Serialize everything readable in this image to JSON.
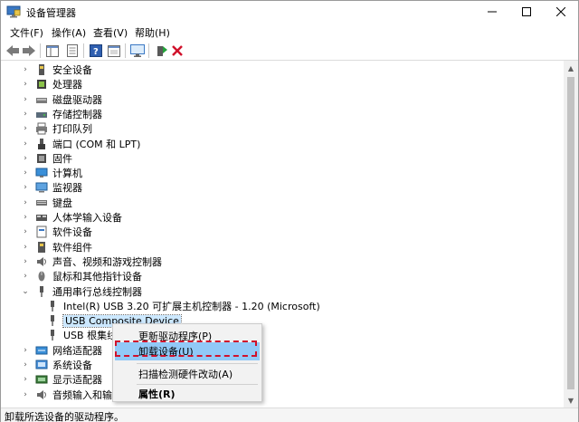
{
  "window": {
    "title": "设备管理器"
  },
  "menu": [
    "文件(F)",
    "操作(A)",
    "查看(V)",
    "帮助(H)"
  ],
  "tree": [
    {
      "label": "安全设备",
      "icon": "security-device-icon",
      "expander": "›"
    },
    {
      "label": "处理器",
      "icon": "processor-icon",
      "expander": "›"
    },
    {
      "label": "磁盘驱动器",
      "icon": "disk-drive-icon",
      "expander": "›"
    },
    {
      "label": "存储控制器",
      "icon": "storage-controller-icon",
      "expander": "›"
    },
    {
      "label": "打印队列",
      "icon": "printer-icon",
      "expander": "›"
    },
    {
      "label": "端口 (COM 和 LPT)",
      "icon": "port-icon",
      "expander": "›"
    },
    {
      "label": "固件",
      "icon": "firmware-icon",
      "expander": "›"
    },
    {
      "label": "计算机",
      "icon": "computer-icon",
      "expander": "›"
    },
    {
      "label": "监视器",
      "icon": "monitor-icon",
      "expander": "›"
    },
    {
      "label": "键盘",
      "icon": "keyboard-icon",
      "expander": "›"
    },
    {
      "label": "人体学输入设备",
      "icon": "hid-icon",
      "expander": "›"
    },
    {
      "label": "软件设备",
      "icon": "software-device-icon",
      "expander": "›"
    },
    {
      "label": "软件组件",
      "icon": "software-component-icon",
      "expander": "›"
    },
    {
      "label": "声音、视频和游戏控制器",
      "icon": "sound-icon",
      "expander": "›"
    },
    {
      "label": "鼠标和其他指针设备",
      "icon": "mouse-icon",
      "expander": "›"
    },
    {
      "label": "通用串行总线控制器",
      "icon": "usb-controller-icon",
      "expander": "⌄"
    },
    {
      "label": "Intel(R) USB 3.20 可扩展主机控制器 - 1.20 (Microsoft)",
      "icon": "usb-icon",
      "child": true
    },
    {
      "label": "USB Composite Device",
      "icon": "usb-icon",
      "child": true,
      "selected": true
    },
    {
      "label": "USB 根集线器",
      "icon": "usb-icon",
      "child": true
    },
    {
      "label": "网络适配器",
      "icon": "network-adapter-icon",
      "expander": "›"
    },
    {
      "label": "系统设备",
      "icon": "system-device-icon",
      "expander": "›"
    },
    {
      "label": "显示适配器",
      "icon": "display-adapter-icon",
      "expander": "›"
    },
    {
      "label": "音频输入和输出",
      "icon": "audio-io-icon",
      "expander": "›"
    }
  ],
  "context_menu": {
    "update_driver": "更新驱动程序(P)",
    "uninstall_device": "卸载设备(U)",
    "scan_hardware": "扫描检测硬件改动(A)",
    "properties": "属性(R)"
  },
  "status": "卸载所选设备的驱动程序。",
  "colors": {
    "selection": "#cce8ff",
    "menu_highlight": "#91c9f7",
    "annotation": "#d0112b",
    "delete": "#d0112b"
  }
}
